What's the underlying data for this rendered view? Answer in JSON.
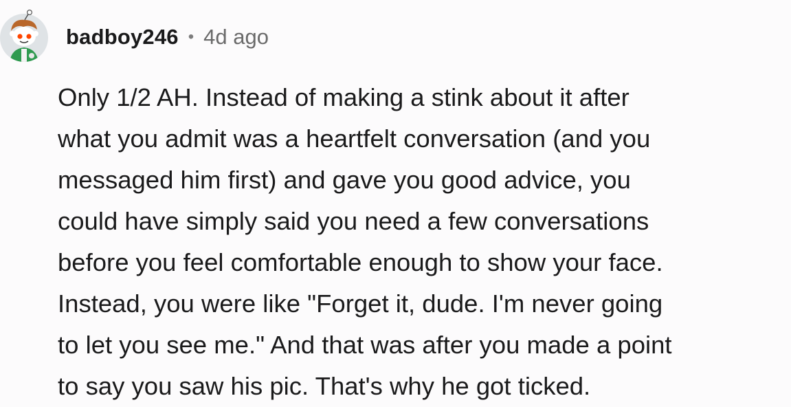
{
  "comment": {
    "author": "badboy246",
    "separator": "•",
    "timestamp": "4d ago",
    "avatar_icon": "snoo-avatar-icon",
    "lines": [
      "Only 1/2 AH. Instead of making a stink about it after",
      "what you admit was a heartfelt conversation (and you",
      "messaged him first) and gave you good advice, you",
      "could have simply said you need a few conversations",
      "before you feel comfortable enough to show your face.",
      "Instead, you were like \"Forget it, dude. I'm never going",
      "to let you see me.\" And that was after you made a point",
      "to say you saw his pic. That's why he got ticked."
    ]
  }
}
